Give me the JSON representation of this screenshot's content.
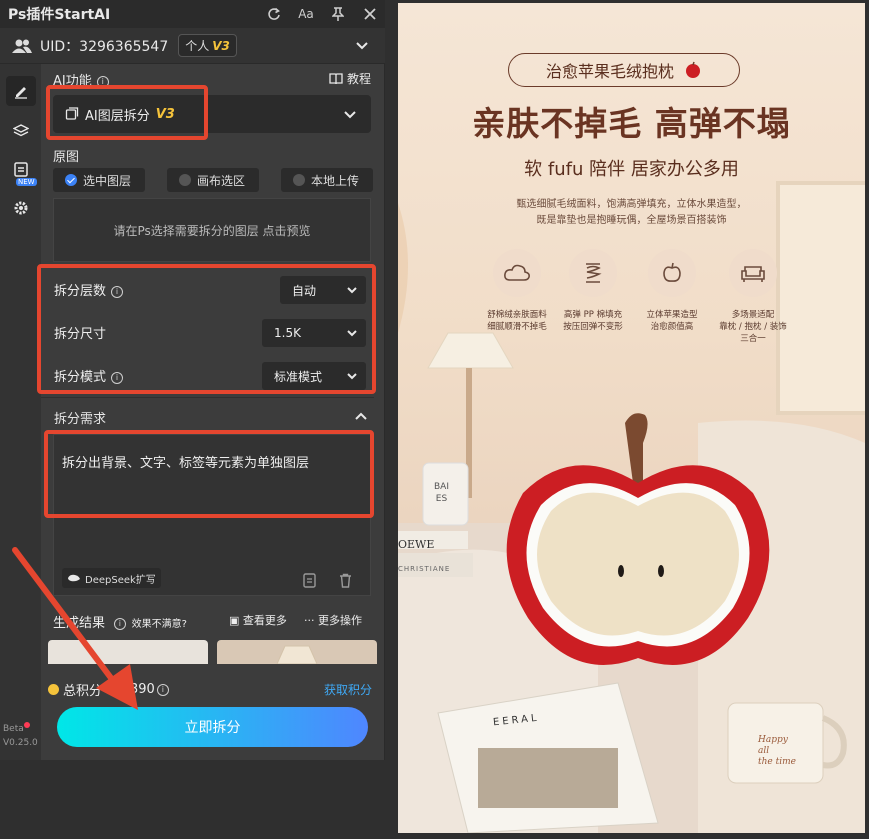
{
  "app": {
    "title": "Ps插件StartAI",
    "font_tool_label": "Aa"
  },
  "user": {
    "uid_label": "UID：3296365547",
    "plan_label": "个人",
    "plan_version": "V3"
  },
  "ai_function": {
    "label": "AI功能",
    "tutorial_label": "教程",
    "selected": "AI图层拆分",
    "selected_version": "V3"
  },
  "source": {
    "label": "原图",
    "options": [
      "选中图层",
      "画布选区",
      "本地上传"
    ],
    "selected_index": 0,
    "hint": "请在Ps选择需要拆分的图层 点击预览"
  },
  "settings": {
    "layers_label": "拆分层数",
    "layers_value": "自动",
    "size_label": "拆分尺寸",
    "size_value": "1.5K",
    "mode_label": "拆分模式",
    "mode_value": "标准模式"
  },
  "requirement": {
    "label": "拆分需求",
    "text": "拆分出背景、文字、标签等元素为单独图层",
    "deepseek_label": "DeepSeek扩写"
  },
  "result": {
    "label": "生成结果",
    "unsatisfied_label": "效果不满意?",
    "view_more_label": "查看更多",
    "more_actions_label": "更多操作"
  },
  "points": {
    "label": "总积分",
    "value": "390",
    "get_label": "获取积分"
  },
  "action": {
    "split_button": "立即拆分"
  },
  "version": {
    "beta": "Beta",
    "number": "V0.25.0"
  },
  "product": {
    "tag": "治愈苹果毛绒抱枕",
    "headline": "亲肤不掉毛  高弹不塌",
    "subheadline": "软 fufu 陪伴  居家办公多用",
    "description_line1": "甄选细腻毛绒面料，饱满高弹填充，立体水果造型，",
    "description_line2": "既是靠垫也是抱睡玩偶，全屋场景百搭装饰",
    "features": [
      {
        "icon": "cloud-icon",
        "line1": "舒棉绒亲肤面料",
        "line2": "细腻顺滑不掉毛"
      },
      {
        "icon": "spring-icon",
        "line1": "高弹 PP 棉填充",
        "line2": "按压回弹不变形"
      },
      {
        "icon": "apple-icon",
        "line1": "立体苹果造型",
        "line2": "治愈颜值高"
      },
      {
        "icon": "sofa-icon",
        "line1": "多场景适配",
        "line2": "靠枕 / 抱枕 / 装饰",
        "line3": "三合一"
      }
    ],
    "candle_label_line1": "BAI",
    "candle_label_line2": "ES",
    "book_title": "OEWE",
    "book_subtitle": "CHRISTIANE",
    "magazine_title": "EERAL",
    "mug_text_line1": "Happy",
    "mug_text_line2": "all",
    "mug_text_line3": "the time"
  },
  "colors": {
    "accent_blue": "#3b82f6",
    "highlight_red": "#e5462f",
    "gold": "#f5c33b",
    "link_blue": "#3fa9f5",
    "apple_red": "#cc1e23"
  }
}
